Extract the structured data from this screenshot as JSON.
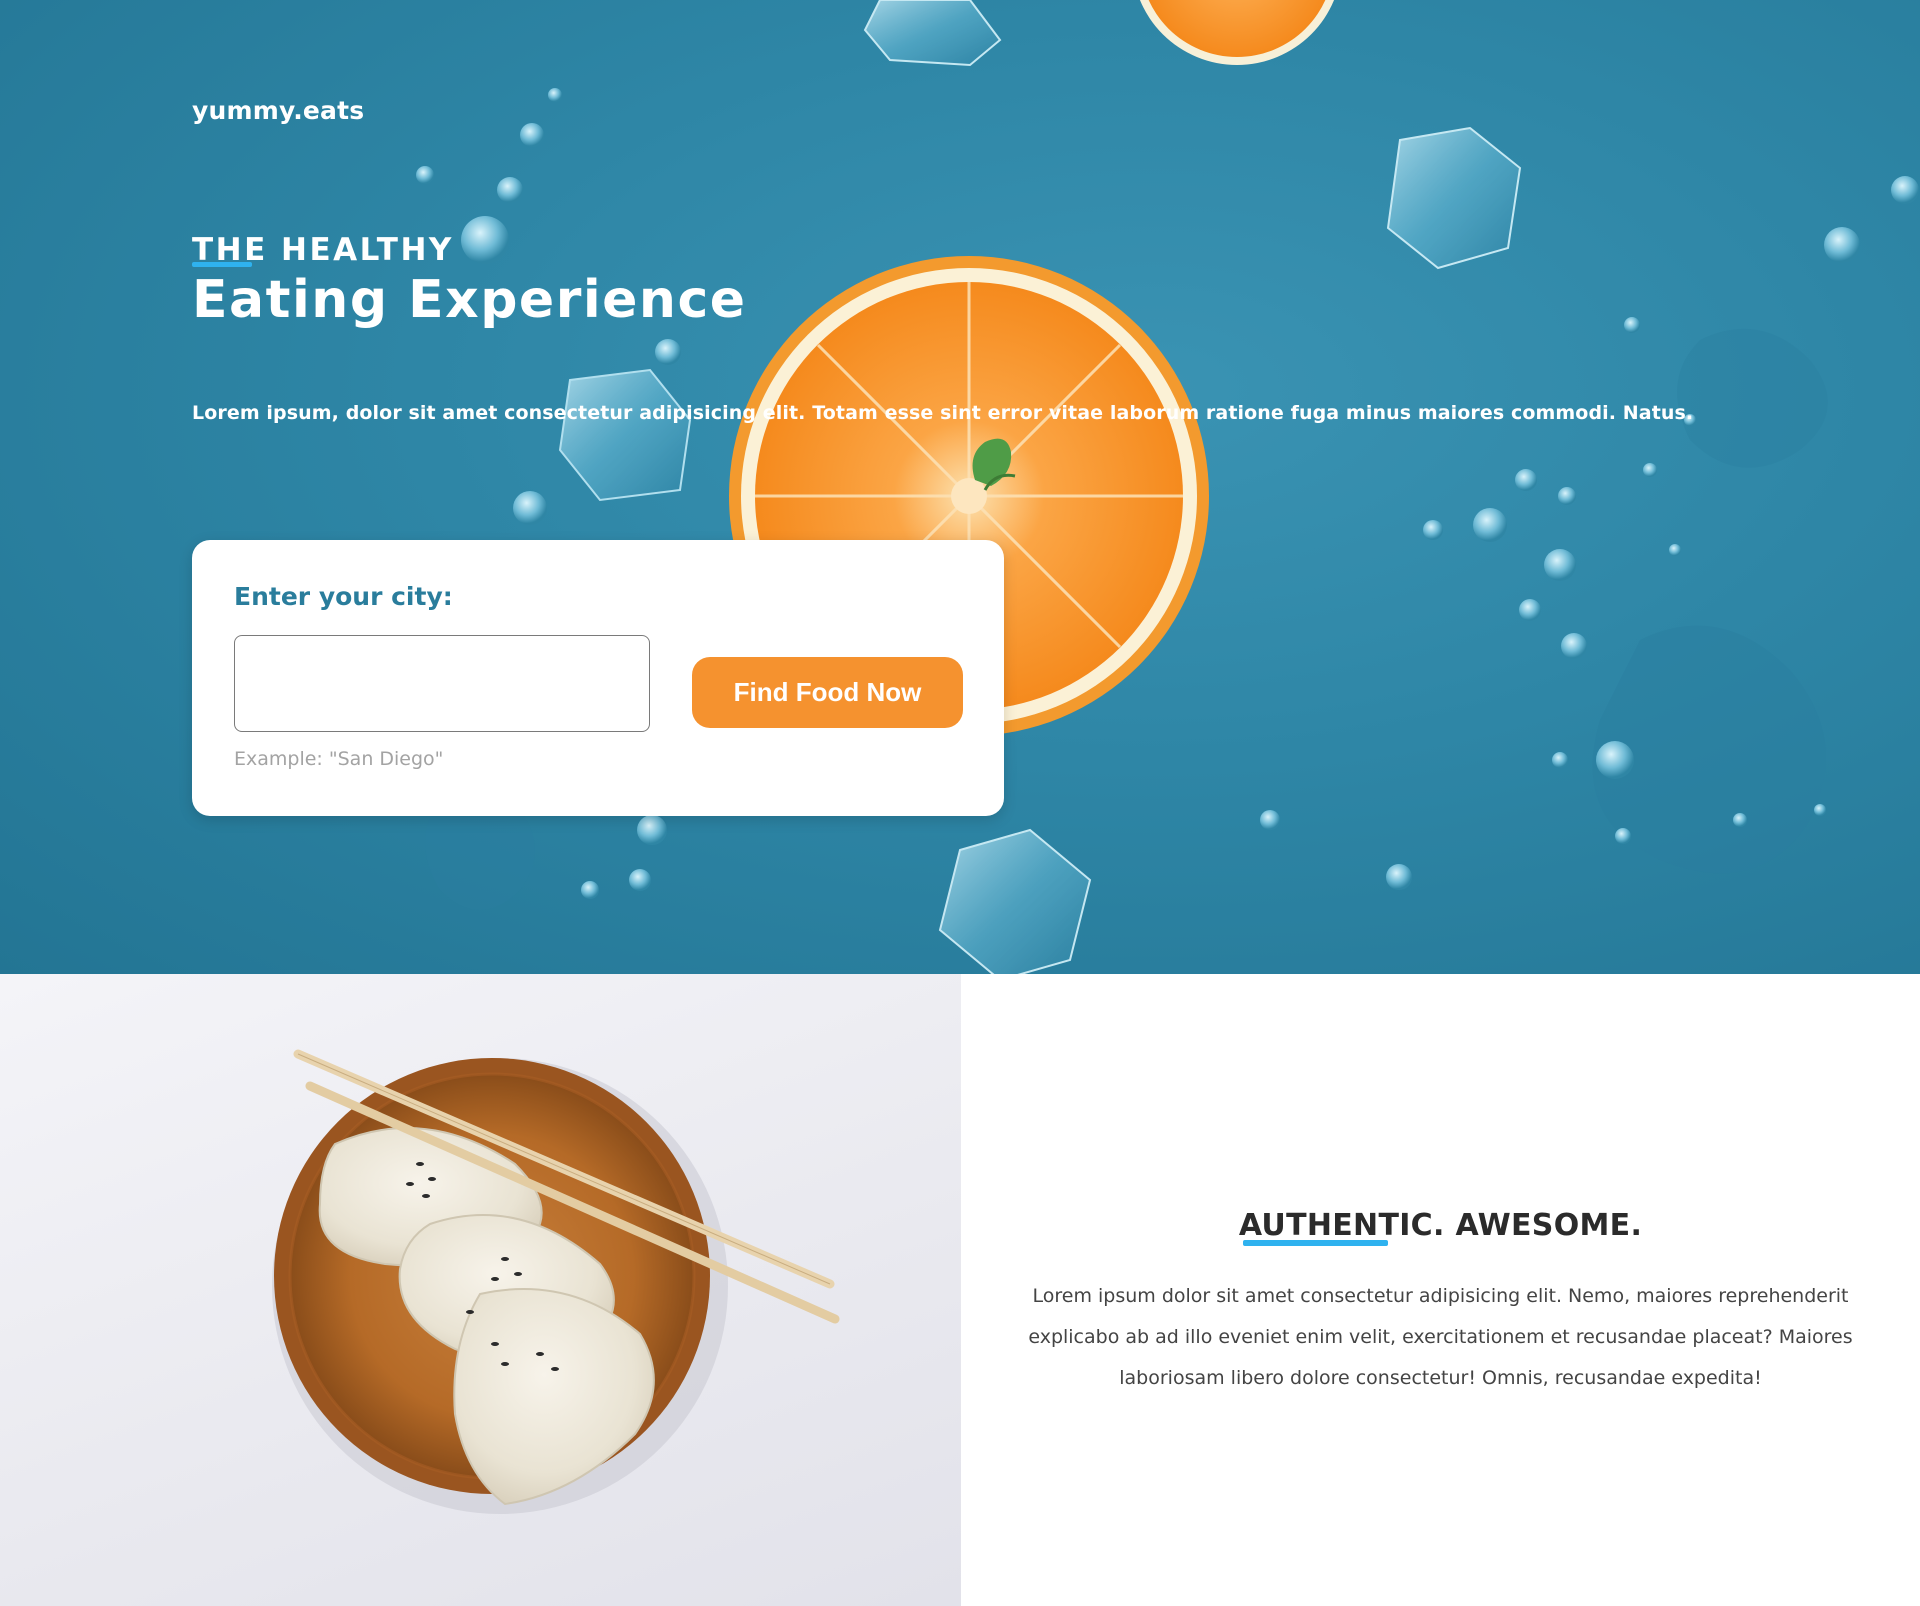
{
  "brand": {
    "name": "yummy.eats"
  },
  "hero": {
    "eyebrow": "THE HEALTHY",
    "headline": "Eating Experience",
    "lead": "Lorem ipsum, dolor sit amet consectetur adipisicing elit. Totam esse sint error vitae laborum ratione fuga minus maiores commodi. Natus."
  },
  "search": {
    "label": "Enter your city:",
    "input_value": "",
    "hint": "Example: \"San Diego\"",
    "button_label": "Find Food Now"
  },
  "feature": {
    "title": "AUTHENTIC. AWESOME.",
    "body": "Lorem ipsum dolor sit amet consectetur adipisicing elit. Nemo, maiores reprehenderit explicabo ab ad illo eveniet enim velit, exercitationem et recusandae placeat? Maiores laboriosam libero dolore consectetur! Omnis, recusandae expedita!"
  },
  "colors": {
    "hero_background": "#2e86a6",
    "accent_orange": "#f5922f",
    "accent_blue": "#2fb2ef",
    "label_teal": "#2a7d9c"
  },
  "images": {
    "hero": "orange-slices-and-ice-on-blue",
    "feature": "dumplings-on-wooden-plate-with-chopsticks"
  }
}
